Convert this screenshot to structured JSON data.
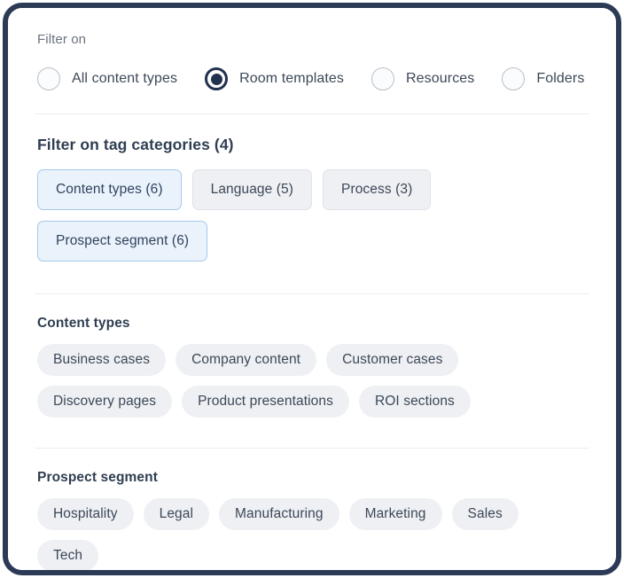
{
  "panel": {
    "filter_on_label": "Filter on",
    "content_type_options": [
      {
        "label": "All content types",
        "selected": false
      },
      {
        "label": "Room templates",
        "selected": true
      },
      {
        "label": "Resources",
        "selected": false
      },
      {
        "label": "Folders",
        "selected": false
      }
    ],
    "tag_categories_heading": "Filter on tag categories (4)",
    "tag_categories": [
      {
        "label": "Content types (6)",
        "selected": true
      },
      {
        "label": "Language (5)",
        "selected": false
      },
      {
        "label": "Process (3)",
        "selected": false
      },
      {
        "label": "Prospect segment (6)",
        "selected": true
      }
    ],
    "sections": [
      {
        "title": "Content types",
        "tags": [
          "Business cases",
          "Company content",
          "Customer cases",
          "Discovery pages",
          "Product presentations",
          "ROI sections"
        ]
      },
      {
        "title": "Prospect segment",
        "tags": [
          "Hospitality",
          "Legal",
          "Manufacturing",
          "Marketing",
          "Sales",
          "Tech"
        ]
      }
    ]
  },
  "colors": {
    "frame": "#2b3a55",
    "accent_selected_chip_bg": "#eaf2fc",
    "accent_selected_chip_border": "#a7c8ea",
    "chip_bg": "#eef0f3",
    "radio_selected": "#22314e",
    "text_primary": "#3d4858",
    "text_muted": "#6b7280"
  }
}
